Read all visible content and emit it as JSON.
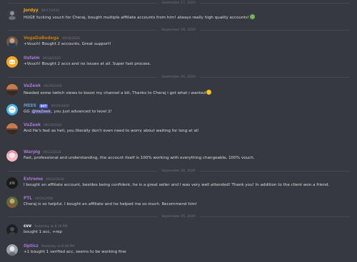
{
  "dividers": [
    "September 17, 2020",
    "September 18, 2020",
    "September 20, 2020",
    "September 24, 2020",
    "September 25, 2020"
  ],
  "messages": [
    {
      "user": "Jordyy",
      "user_color": "#faa61a",
      "time": "09/17/2020",
      "pre": "HUGE fucking vouch for Cheraj, bought multiple affiliate accounts from him! always really high quality accounts!",
      "mention": "",
      "post": "",
      "bot_badge": "",
      "emoji": "smile-emoji"
    },
    {
      "user": "VegaDaBodega",
      "user_color": "#c27c0e",
      "time": "09/18/2020",
      "pre": "+Vouch! Bought 2 accounts. Great support!",
      "mention": "",
      "post": "",
      "bot_badge": "",
      "emoji": ""
    },
    {
      "user": "itsfaim",
      "user_color": "#a576d6",
      "time": "09/18/2020",
      "pre": "+Vouch! Bought 2 accs and no issues at all. Super fast process.",
      "mention": "",
      "post": "",
      "bot_badge": "",
      "emoji": ""
    },
    {
      "user": "VaZeek",
      "user_color": "#a576d6",
      "time": "09/20/2020",
      "pre": "Needed some twitch views to boost my channel a bit, Thanks to Cheraj i got what i wanted",
      "mention": "",
      "post": "",
      "bot_badge": "",
      "emoji": "grin-emoji"
    },
    {
      "user": "MEE6",
      "user_color": "#5b9bd5",
      "time": "09/20/2020",
      "pre": "GG ",
      "mention": "@VaZeek",
      "post": ", you just advanced to level 2!",
      "bot_badge": "BOT",
      "emoji": ""
    },
    {
      "user": "VaZeek",
      "user_color": "#a576d6",
      "time": "09/20/2020",
      "pre": "And He's fast as hell, you literally don't even need to worry about waiting for long at all",
      "mention": "",
      "post": "",
      "bot_badge": "",
      "emoji": ""
    },
    {
      "user": "Warpig",
      "user_color": "#a576d6",
      "time": "09/23/2020",
      "pre": "Fast, professional and understanding, the account itself is 100% working with everything changeable, 100% vouch.",
      "mention": "",
      "post": "",
      "bot_badge": "",
      "emoji": ""
    },
    {
      "user": "Extreme",
      "user_color": "#a576d6",
      "time": "09/24/2020",
      "pre": "I bought an affiliate account, besides being confident, he is a great seller and I was very well attended! Thank you! In addition to the client won a friend.",
      "mention": "",
      "post": "",
      "bot_badge": "",
      "emoji": ""
    },
    {
      "user": "PTL",
      "user_color": "#a576d6",
      "time": "09/24/2020",
      "pre": "Cheraj is so helpful. I bought an affiliate and he helped me so much. Recommend him!",
      "mention": "",
      "post": "",
      "bot_badge": "",
      "emoji": ""
    },
    {
      "user": "cvv",
      "user_color": "#ffffff",
      "time": "Yesterday at 8:16 PM",
      "pre": "bought 1 acc, +rep",
      "mention": "",
      "post": "",
      "bot_badge": "",
      "emoji": ""
    },
    {
      "user": "Opticz",
      "user_color": "#a576d6",
      "time": "Yesterday at 8:48 PM",
      "pre": "+1 bought 1 verified acc, seems to be working fine",
      "mention": "",
      "post": "",
      "bot_badge": "",
      "emoji": ""
    }
  ],
  "colors": {
    "background": "#36393f",
    "text": "#dcddde",
    "muted": "#72767d",
    "mention_bg": "#414675",
    "bot_badge": "#5865f2"
  }
}
